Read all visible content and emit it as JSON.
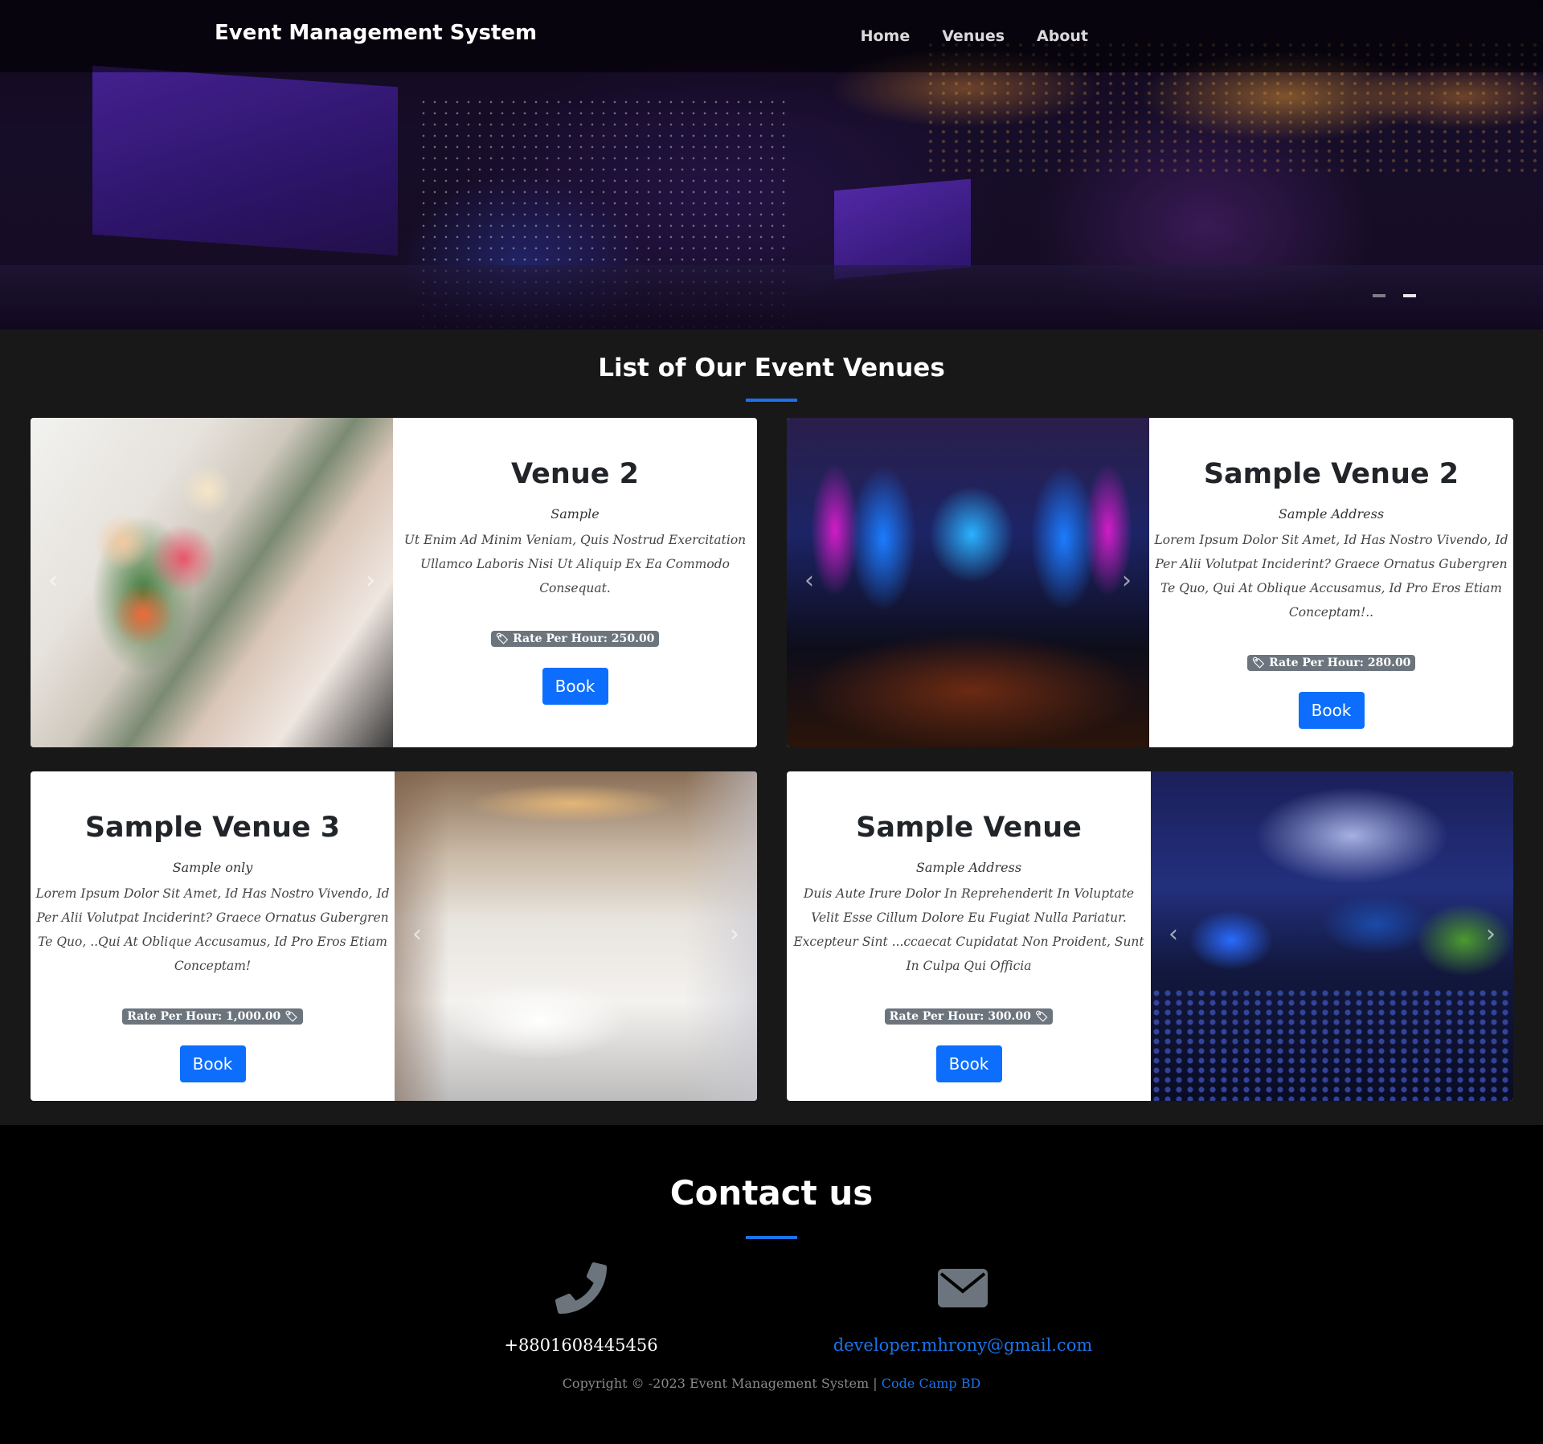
{
  "navbar": {
    "brand": "Event Management System",
    "links": [
      "Home",
      "Venues",
      "About"
    ]
  },
  "hero": {
    "carousel_active_index": 1,
    "carousel_count": 2
  },
  "venues": {
    "title": "List of Our Event Venues",
    "rate_label": "Rate Per Hour:",
    "book_label": "Book",
    "items": [
      {
        "name": "Venue 2",
        "address": "Sample",
        "description": "Ut Enim Ad Minim Veniam, Quis Nostrud Exercitation Ullamco Laboris Nisi Ut Aliquip Ex Ea Commodo Consequat.",
        "rate": "Rate Per Hour: 250.00",
        "image_side": "left"
      },
      {
        "name": "Sample Venue 2",
        "address": "Sample Address",
        "description": "Lorem Ipsum Dolor Sit Amet, Id Has Nostro Vivendo, Id Per Alii Volutpat Inciderint? Graece Ornatus Gubergren Te Quo, Qui At Oblique Accusamus, Id Pro Eros Etiam Conceptam!..",
        "rate": "Rate Per Hour: 280.00",
        "image_side": "left"
      },
      {
        "name": "Sample Venue 3",
        "address": "Sample only",
        "description": "Lorem Ipsum Dolor Sit Amet, Id Has Nostro Vivendo, Id Per Alii Volutpat Inciderint? Graece Ornatus Gubergren Te Quo, ..Qui At Oblique Accusamus, Id Pro Eros Etiam Conceptam!",
        "rate": "Rate Per Hour: 1,000.00",
        "image_side": "right"
      },
      {
        "name": "Sample Venue",
        "address": "Sample Address",
        "description": "Duis Aute Irure Dolor In Reprehenderit In Voluptate Velit Esse Cillum Dolore Eu Fugiat Nulla Pariatur. Excepteur Sint ...ccaecat Cupidatat Non Proident, Sunt In Culpa Qui Officia",
        "rate": "Rate Per Hour: 300.00",
        "image_side": "right"
      }
    ]
  },
  "contact": {
    "title": "Contact us",
    "phone": "+8801608445456",
    "email": "developer.mhrony@gmail.com",
    "phone_icon": "phone-icon",
    "email_icon": "envelope-icon"
  },
  "footer": {
    "copyright": "Copyright © -2023 Event Management System |",
    "credit": "Code Camp BD"
  },
  "colors": {
    "accent": "#1a73e8",
    "button": "#0d6efd",
    "badge": "#6c757d",
    "venues_bg": "#181818",
    "contact_bg": "#000000"
  }
}
